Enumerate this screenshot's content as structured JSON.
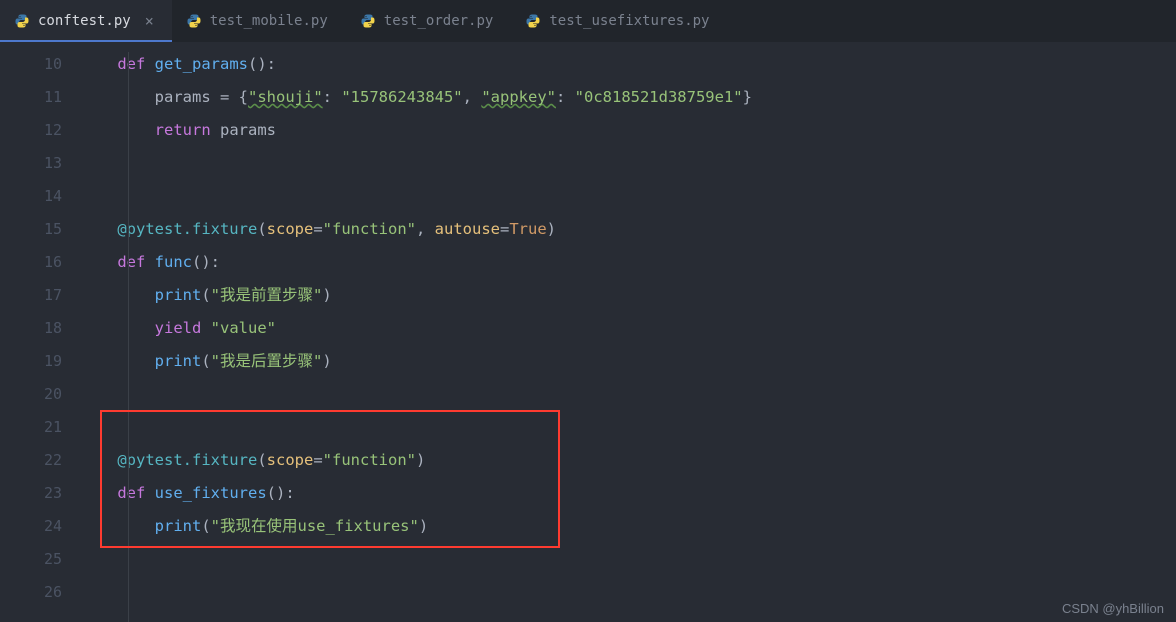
{
  "tabs": [
    {
      "label": "conftest.py",
      "active": true
    },
    {
      "label": "test_mobile.py",
      "active": false
    },
    {
      "label": "test_order.py",
      "active": false
    },
    {
      "label": "test_usefixtures.py",
      "active": false
    }
  ],
  "line_start": 10,
  "line_end": 26,
  "code": {
    "l10": {
      "kw": "def",
      "fn": "get_params",
      "tail": "():"
    },
    "l11": {
      "lhs": "params ",
      "eq": "=",
      "obr": " {",
      "k1": "\"shouji\"",
      "colon1": ": ",
      "v1": "\"15786243845\"",
      "comma": ", ",
      "k2": "\"appkey\"",
      "colon2": ": ",
      "v2": "\"0c818521d38759e1\"",
      "cbr": "}"
    },
    "l12": {
      "kw": "return",
      "sp": " ",
      "id": "params"
    },
    "l15": {
      "at": "@pytest.fixture",
      "open": "(",
      "p1n": "scope",
      "eq1": "=",
      "p1v": "\"function\"",
      "comma": ", ",
      "p2n": "autouse",
      "eq2": "=",
      "p2v": "True",
      "close": ")"
    },
    "l16": {
      "kw": "def",
      "fn": "func",
      "tail": "():"
    },
    "l17": {
      "fn": "print",
      "open": "(",
      "s": "\"我是前置步骤\"",
      "close": ")"
    },
    "l18": {
      "kw": "yield",
      "sp": " ",
      "s": "\"value\""
    },
    "l19": {
      "fn": "print",
      "open": "(",
      "s": "\"我是后置步骤\"",
      "close": ")"
    },
    "l22": {
      "at": "@pytest.fixture",
      "open": "(",
      "p1n": "scope",
      "eq1": "=",
      "p1v": "\"function\"",
      "close": ")"
    },
    "l23": {
      "kw": "def",
      "fn": "use_fixtures",
      "tail": "():"
    },
    "l24": {
      "fn": "print",
      "open": "(",
      "s": "\"我现在使用use_fixtures\"",
      "close": ")"
    }
  },
  "watermark": "CSDN @yhBillion"
}
